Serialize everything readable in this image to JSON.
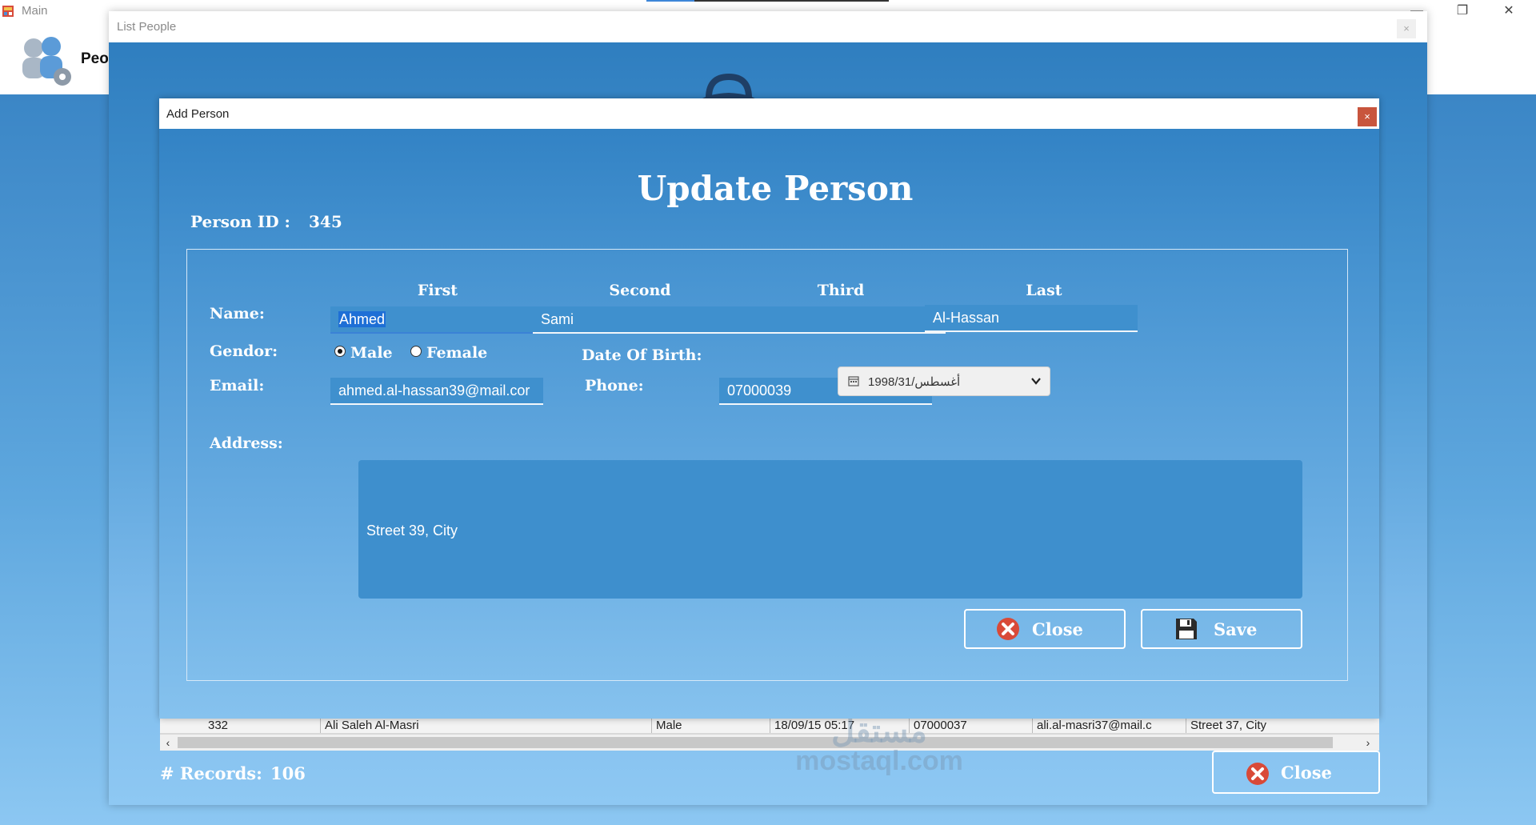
{
  "main_window": {
    "title": "Main",
    "toolbar": {
      "people_label": "Peo"
    }
  },
  "list_window": {
    "title": "List People",
    "close_x": "×",
    "grid_row": [
      "332",
      "Ali Saleh Al-Masri",
      "Male",
      "18/09/15 05:17",
      "07000037",
      "ali.al-masri37@mail.c",
      "Street 37, City"
    ],
    "records_label": "# Records:",
    "records_value": "106",
    "close_button_label": "Close"
  },
  "dialog": {
    "title": "Add Person",
    "close_x": "×",
    "heading": "Update Person",
    "person_id_label": "Person ID :",
    "person_id_value": "345",
    "labels": {
      "name": "Name:",
      "gender": "Gendor:",
      "email": "Email:",
      "address": "Address:",
      "dob": "Date Of Birth:",
      "phone": "Phone:"
    },
    "columns": [
      "First",
      "Second",
      "Third",
      "Last"
    ],
    "name": {
      "first": "Ahmed",
      "second": "Sami",
      "third": "",
      "last": "Al-Hassan"
    },
    "gender_options": {
      "male": "Male",
      "female": "Female",
      "selected": "Male"
    },
    "email": "ahmed.al-hassan39@mail.cor",
    "phone": "07000039",
    "dob": "1998/31/أغسطس",
    "address": "Street 39, City",
    "buttons": {
      "close": "Close",
      "save": "Save"
    }
  },
  "watermark": {
    "arabic": "مستقل",
    "latin": "mostaql.com"
  },
  "colors": {
    "bg_blue": "#3a8ac8",
    "close_red": "#d94a38",
    "dialog_close": "#c8553d",
    "field_blue": "#3f90ce"
  }
}
